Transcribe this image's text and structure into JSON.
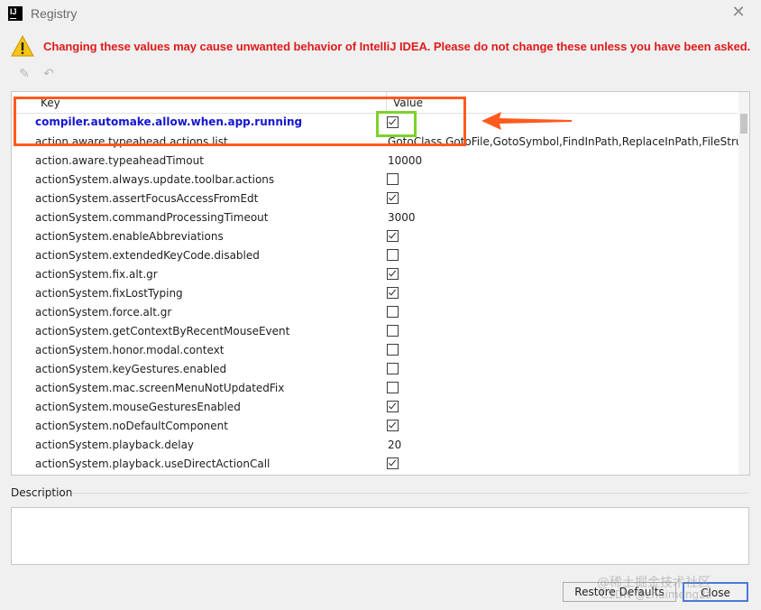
{
  "window": {
    "title": "Registry",
    "close_glyph": "✕"
  },
  "warning": {
    "icon": "warning-triangle-icon",
    "text": "Changing these values may cause unwanted behavior of IntelliJ IDEA. Please do not change these unless you have been asked.",
    "color": "#e01a1a"
  },
  "toolbar": {
    "edit_glyph": "✎",
    "revert_glyph": "↶"
  },
  "table": {
    "columns": {
      "key": "Key",
      "value": "Value"
    },
    "rows": [
      {
        "key": "compiler.automake.allow.when.app.running",
        "type": "checkbox",
        "checked": true,
        "bold": true
      },
      {
        "key": "action.aware.typeahead.actions.list",
        "type": "text",
        "value": "GotoClass,GotoFile,GotoSymbol,FindInPath,ReplaceInPath,FileStruct"
      },
      {
        "key": "action.aware.typeaheadTimout",
        "type": "text",
        "value": "10000"
      },
      {
        "key": "actionSystem.always.update.toolbar.actions",
        "type": "checkbox",
        "checked": false
      },
      {
        "key": "actionSystem.assertFocusAccessFromEdt",
        "type": "checkbox",
        "checked": true
      },
      {
        "key": "actionSystem.commandProcessingTimeout",
        "type": "text",
        "value": "3000"
      },
      {
        "key": "actionSystem.enableAbbreviations",
        "type": "checkbox",
        "checked": true
      },
      {
        "key": "actionSystem.extendedKeyCode.disabled",
        "type": "checkbox",
        "checked": false
      },
      {
        "key": "actionSystem.fix.alt.gr",
        "type": "checkbox",
        "checked": true
      },
      {
        "key": "actionSystem.fixLostTyping",
        "type": "checkbox",
        "checked": true
      },
      {
        "key": "actionSystem.force.alt.gr",
        "type": "checkbox",
        "checked": false
      },
      {
        "key": "actionSystem.getContextByRecentMouseEvent",
        "type": "checkbox",
        "checked": false
      },
      {
        "key": "actionSystem.honor.modal.context",
        "type": "checkbox",
        "checked": false
      },
      {
        "key": "actionSystem.keyGestures.enabled",
        "type": "checkbox",
        "checked": false
      },
      {
        "key": "actionSystem.mac.screenMenuNotUpdatedFix",
        "type": "checkbox",
        "checked": false
      },
      {
        "key": "actionSystem.mouseGesturesEnabled",
        "type": "checkbox",
        "checked": true
      },
      {
        "key": "actionSystem.noDefaultComponent",
        "type": "checkbox",
        "checked": true
      },
      {
        "key": "actionSystem.playback.delay",
        "type": "text",
        "value": "20"
      },
      {
        "key": "actionSystem.playback.useDirectActionCall",
        "type": "checkbox",
        "checked": true
      }
    ]
  },
  "description": {
    "label": "Description"
  },
  "buttons": {
    "restore": "Restore Defaults",
    "close": "Close"
  },
  "watermark": {
    "line1": "@稀土掘金技术社区",
    "line2": "CSDN @zhuimeng2z"
  },
  "colors": {
    "highlight_box": "#ff5a1f",
    "checkbox_highlight": "#7dd22a",
    "bold_key": "#1515d0"
  }
}
